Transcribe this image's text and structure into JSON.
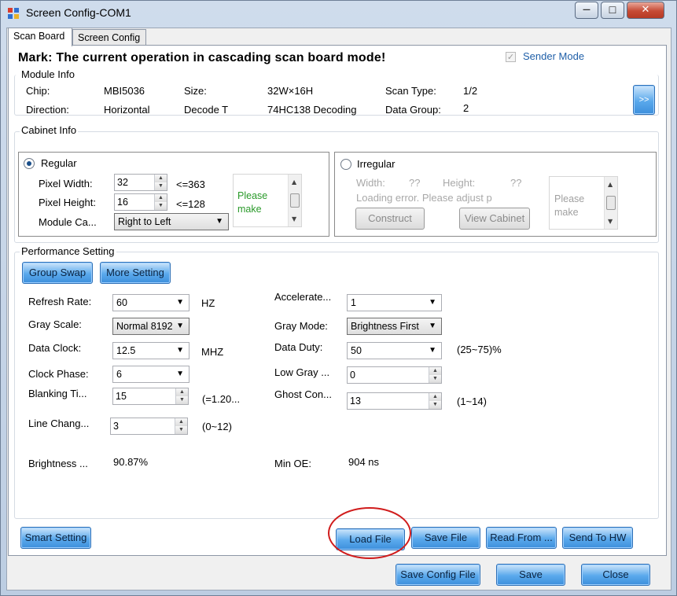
{
  "window": {
    "title": "Screen Config-COM1",
    "minimize_glyph": "—",
    "maximize_glyph": "☐",
    "close_glyph": "✕"
  },
  "tabs": [
    {
      "label": "Scan Board",
      "active": true
    },
    {
      "label": "Screen Config",
      "active": false
    }
  ],
  "mark_text": "Mark: The current operation in cascading scan board mode!",
  "sender_mode": {
    "label": "Sender Mode",
    "checked": true,
    "check_glyph": "✓"
  },
  "module_info": {
    "title": "Module Info",
    "chip_label": "Chip:",
    "chip_value": "MBI5036",
    "size_label": "Size:",
    "size_value": "32W×16H",
    "scan_type_label": "Scan Type:",
    "scan_type_value": "1/2",
    "direction_label": "Direction:",
    "direction_value": "Horizontal",
    "decode_label": "Decode T",
    "decode_value": "74HC138 Decoding",
    "data_group_label": "Data Group:",
    "data_group_value": "2",
    "more_button": ">>"
  },
  "cabinet_info": {
    "title": "Cabinet Info",
    "regular": {
      "label": "Regular",
      "selected": true,
      "pixel_width_label": "Pixel Width:",
      "pixel_width_value": "32",
      "pixel_width_limit": "<=363",
      "pixel_height_label": "Pixel Height:",
      "pixel_height_value": "16",
      "pixel_height_limit": "<=128",
      "module_cascade_label": "Module Ca...",
      "module_cascade_value": "Right to Left",
      "note_line1": "Please",
      "note_line2": "make"
    },
    "irregular": {
      "label": "Irregular",
      "selected": false,
      "width_label": "Width:",
      "width_value": "??",
      "height_label": "Height:",
      "height_value": "??",
      "error_text": "Loading error. Please adjust p",
      "construct_button": "Construct",
      "view_cabinet_button": "View Cabinet",
      "note_line1": "Please",
      "note_line2": "make"
    }
  },
  "performance": {
    "title": "Performance Setting",
    "group_swap_button": "Group Swap",
    "more_setting_button": "More Setting",
    "refresh_rate_label": "Refresh Rate:",
    "refresh_rate_value": "60",
    "refresh_rate_unit": "HZ",
    "gray_scale_label": "Gray Scale:",
    "gray_scale_value": "Normal  8192",
    "data_clock_label": "Data Clock:",
    "data_clock_value": "12.5",
    "data_clock_unit": "MHZ",
    "clock_phase_label": "Clock Phase:",
    "clock_phase_value": "6",
    "blanking_label": "Blanking Ti...",
    "blanking_value": "15",
    "blanking_hint": "(=1.20...",
    "line_change_label": "Line Chang...",
    "line_change_value": "3",
    "line_change_hint": "(0~12)",
    "accelerate_label": "Accelerate...",
    "accelerate_value": "1",
    "gray_mode_label": "Gray Mode:",
    "gray_mode_value": "Brightness First",
    "data_duty_label": "Data Duty:",
    "data_duty_value": "50",
    "data_duty_hint": "(25~75)%",
    "low_gray_label": "Low Gray ...",
    "low_gray_value": "0",
    "ghost_label": "Ghost Con...",
    "ghost_value": "13",
    "ghost_hint": "(1~14)",
    "brightness_label": "Brightness ...",
    "brightness_value": "90.87%",
    "min_oe_label": "Min OE:",
    "min_oe_value": "904 ns"
  },
  "actions": {
    "smart_setting": "Smart Setting",
    "load_file": "Load File",
    "save_file": "Save File",
    "read_from": "Read From ...",
    "send_to_hw": "Send To HW"
  },
  "footer": {
    "save_config_file": "Save Config File",
    "save": "Save",
    "close": "Close"
  },
  "colors": {
    "accent_button": "#5aa9ec",
    "highlight_circle": "#d01c1c",
    "note_text": "#2a9a2a"
  }
}
